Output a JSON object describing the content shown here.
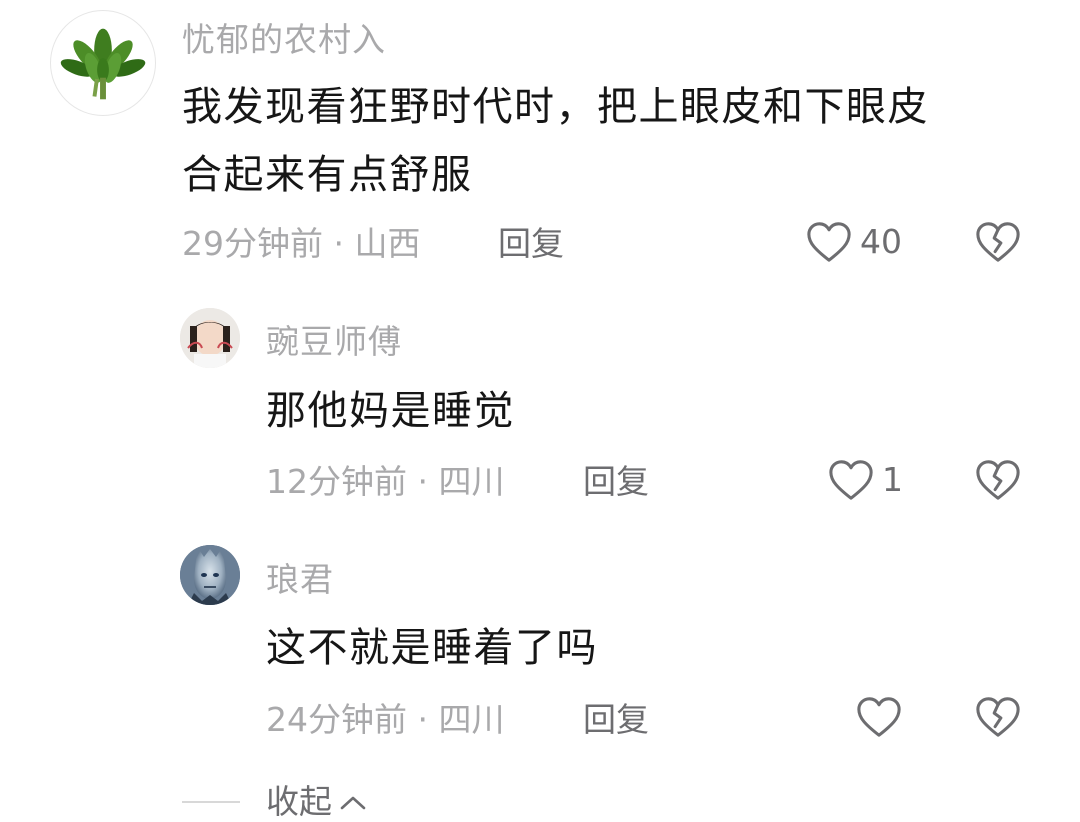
{
  "comments": [
    {
      "username": "忧郁的农村入",
      "content_lines": [
        "我发现看狂野时代时，把上眼皮和下眼皮",
        "合起来有点舒服"
      ],
      "time_location": "29分钟前 · 山西",
      "reply_label": "回复",
      "likes": "40",
      "avatar_icon": "green-plant-avatar"
    },
    {
      "username": "豌豆师傅",
      "content_lines": [
        "那他妈是睡觉"
      ],
      "time_location": "12分钟前 · 四川",
      "reply_label": "回复",
      "likes": "1",
      "avatar_icon": "girl-photo-avatar"
    },
    {
      "username": "琅君",
      "content_lines": [
        "这不就是睡着了吗"
      ],
      "time_location": "24分钟前 · 四川",
      "reply_label": "回复",
      "likes": "",
      "avatar_icon": "night-king-avatar"
    }
  ],
  "collapse_label": "收起",
  "icons": {
    "like": "heart-outline-icon",
    "dislike": "broken-heart-icon",
    "collapse": "chevron-up-icon"
  },
  "colors": {
    "username": "#a9a9ab",
    "content": "#161616",
    "meta": "#a9a9ab",
    "action": "#6d6d70"
  }
}
